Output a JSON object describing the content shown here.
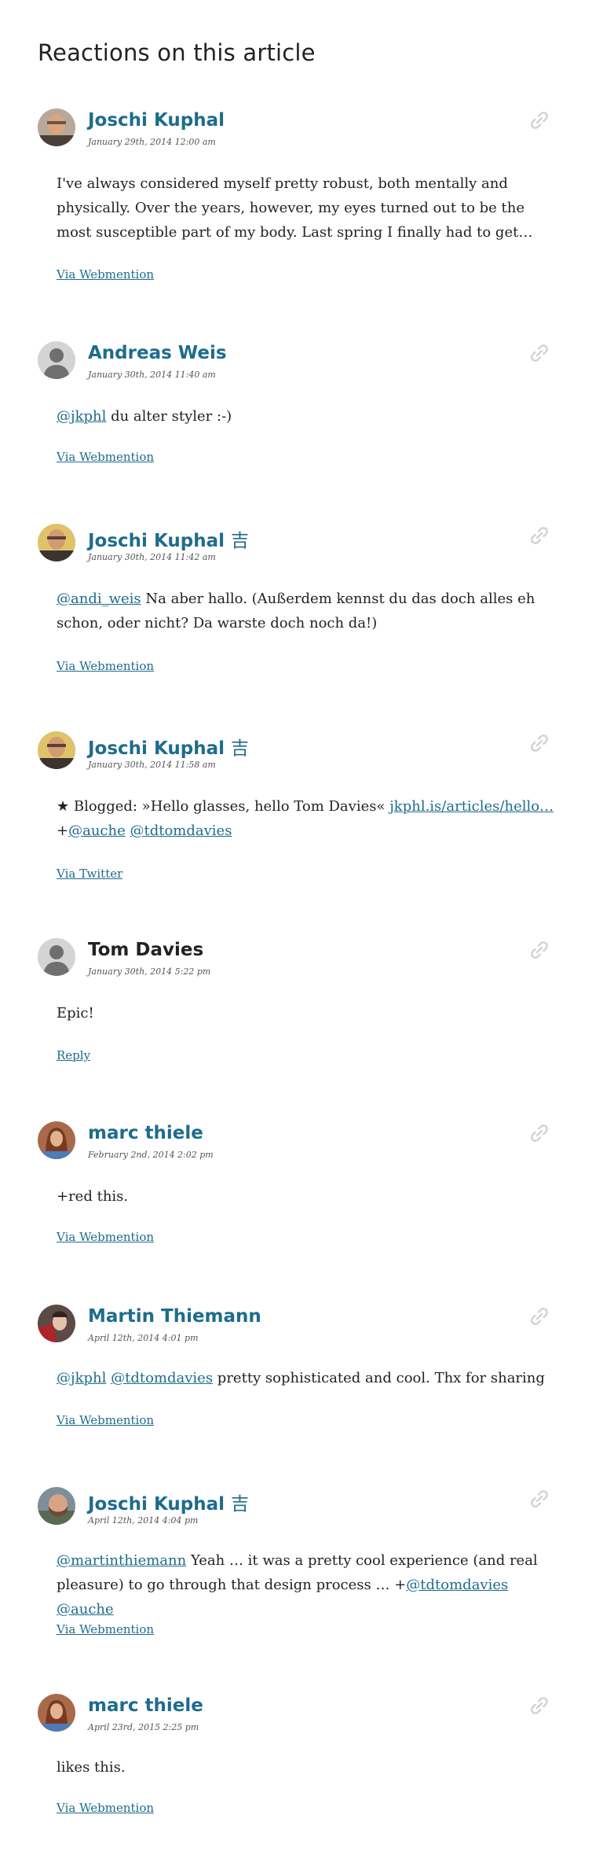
{
  "section_title": "Reactions on this article",
  "reactions": [
    {
      "author": "Joschi Kuphal",
      "date": "January 29th, 2014 12:00 am",
      "text": "I've always considered myself pretty robust, both mentally and physically. Over the years, however, my eyes turned out to be the most susceptible part of my body. Last spring I finally had to get…",
      "source": "Via Webmention"
    },
    {
      "author": "Andreas Weis",
      "date": "January 30th, 2014 11:40 am",
      "mention": "@jkphl",
      "text": " du alter styler :-)",
      "source": "Via Webmention"
    },
    {
      "author": "Joschi Kuphal",
      "author_mark": "吉",
      "date": "January 30th, 2014 11:42 am",
      "mention": "@andi_weis",
      "text": " Na aber hallo. (Außerdem kennst du das doch alles eh schon, oder nicht? Da warste doch noch da!)",
      "source": "Via Webmention"
    },
    {
      "author": "Joschi Kuphal",
      "author_mark": "吉",
      "date": "January 30th, 2014 11:58 am",
      "text": "★ Blogged: »Hello glasses, hello Tom Davies« ",
      "link": "jkphl.is/articles/hello…",
      "plus": "+",
      "mention_1": "@auche",
      "mention_2": "@tdtomdavies",
      "source": "Via Twitter"
    },
    {
      "author": "Tom Davies",
      "date": "January 30th, 2014 5:22 pm",
      "text": "Epic!",
      "source": "Reply"
    },
    {
      "author": "marc thiele",
      "date": "February 2nd, 2014 2:02 pm",
      "text": "+red this.",
      "source": "Via Webmention"
    },
    {
      "author": "Martin Thiemann",
      "date": "April 12th, 2014 4:01 pm",
      "mention_1": "@jkphl",
      "mention_2": "@tdtomdavies",
      "text": " pretty sophisticated and cool. Thx for sharing",
      "source": "Via Webmention"
    },
    {
      "author": "Joschi Kuphal",
      "author_mark": "吉",
      "date": "April 12th, 2014 4:04 pm",
      "mention_1": "@martinthiemann",
      "text": " Yeah … it was a pretty cool experience (and real pleasure) to go through that design process … +",
      "mention_2": "@tdtomdavies",
      "mention_3": "@auche",
      "source": "Via Webmention"
    },
    {
      "author": "marc thiele",
      "date": "April 23rd, 2015 2:25 pm",
      "text": "likes this.",
      "source": "Via Webmention"
    }
  ]
}
